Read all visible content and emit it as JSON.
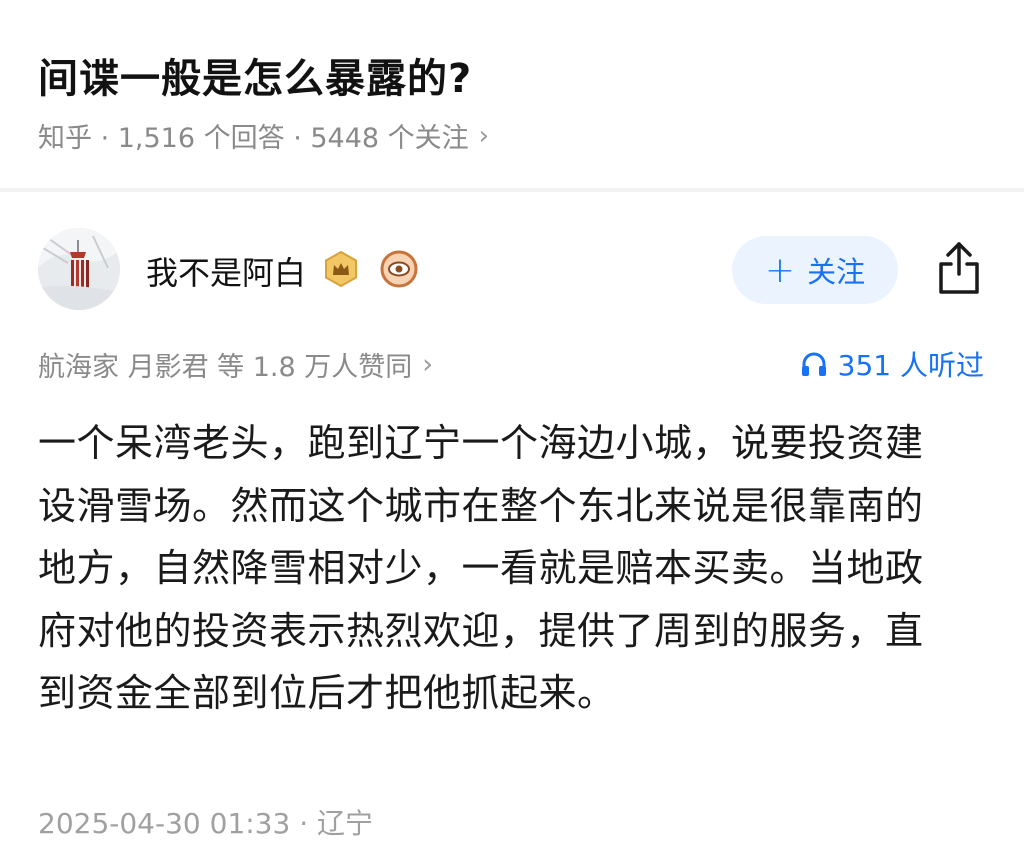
{
  "question": {
    "title": "间谍一般是怎么暴露的?",
    "meta": "知乎 · 1,516 个回答 · 5448 个关注",
    "meta_chevron": "›"
  },
  "author": {
    "name": "我不是阿白",
    "badges": [
      "crown-badge-icon",
      "eye-badge-icon"
    ],
    "follow_label": "关注",
    "follow_plus": "+"
  },
  "upvotes": {
    "text": "航海家 月影君 等 1.8 万人赞同",
    "chevron": "›"
  },
  "listen": {
    "text": "351 人听过",
    "icon": "headphones-icon",
    "color": "#1772f6"
  },
  "answer": {
    "lines": [
      "一个呆湾老头，跑到辽宁一个海边小城，说要投资建",
      "设滑雪场。然而这个城市在整个东北来说是很靠南的",
      "地方，自然降雪相对少，一看就是赔本买卖。当地政",
      "府对他的投资表示热烈欢迎，提供了周到的服务，直",
      "到资金全部到位后才把他抓起来。"
    ],
    "footer": "2025-04-30 01:33 · 辽宁"
  },
  "colors": {
    "accent": "#1772f6",
    "follow_bg": "#ebf3ff",
    "meta_gray": "#8a8a8a"
  }
}
